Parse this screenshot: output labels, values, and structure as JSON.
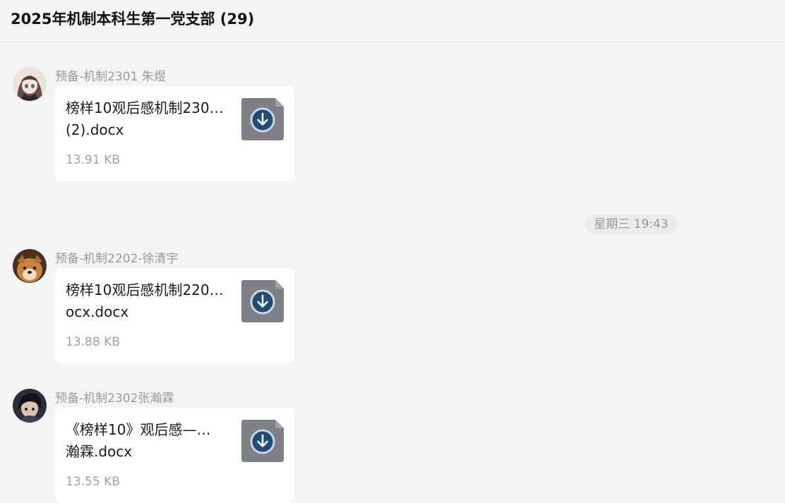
{
  "header": {
    "title": "2025年机制本科生第一党支部 (29)"
  },
  "messages": [
    {
      "sender": "预备-机制2301 朱煜",
      "file": {
        "name_line1": "榜样10观后感机制230…",
        "name_line2": "(2).docx",
        "size": "13.91 KB",
        "icon": "word-doc-download-icon"
      }
    },
    {
      "sender": "预备-机制2202-徐清宇",
      "file": {
        "name_line1": "榜样10观后感机制220…",
        "name_line2": "ocx.docx",
        "size": "13.88 KB",
        "icon": "word-doc-download-icon"
      }
    },
    {
      "sender": "预备-机制2302张瀚霖",
      "file": {
        "name_line1": "《榜样10》观后感—…",
        "name_line2": "瀚霖.docx",
        "size": "13.55 KB",
        "icon": "word-doc-download-icon"
      }
    }
  ],
  "timestamp": "星期三 19:43",
  "colors": {
    "background": "#f4f4f4",
    "card": "#ffffff",
    "muted_text": "#9a9a9a"
  }
}
